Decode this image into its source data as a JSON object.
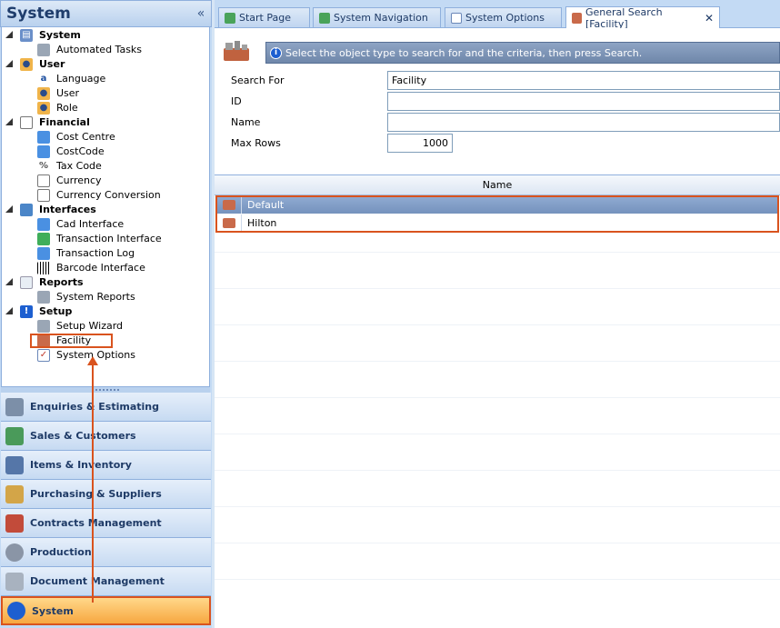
{
  "left": {
    "title": "System",
    "collapse": "«",
    "tree": [
      {
        "label": "System",
        "type": "group",
        "icon": "system-icon"
      },
      {
        "label": "Automated Tasks",
        "type": "child",
        "icon": "automated-tasks-icon"
      },
      {
        "label": "User",
        "type": "group",
        "icon": "user-icon"
      },
      {
        "label": "Language",
        "type": "child",
        "icon": "language-icon"
      },
      {
        "label": "User",
        "type": "child",
        "icon": "user-icon"
      },
      {
        "label": "Role",
        "type": "child",
        "icon": "role-icon"
      },
      {
        "label": "Financial",
        "type": "group",
        "icon": "financial-icon"
      },
      {
        "label": "Cost Centre",
        "type": "child",
        "icon": "cost-centre-icon"
      },
      {
        "label": "CostCode",
        "type": "child",
        "icon": "cost-code-icon"
      },
      {
        "label": "Tax Code",
        "type": "child",
        "icon": "tax-code-icon"
      },
      {
        "label": "Currency",
        "type": "child",
        "icon": "currency-icon"
      },
      {
        "label": "Currency Conversion",
        "type": "child",
        "icon": "currency-conversion-icon"
      },
      {
        "label": "Interfaces",
        "type": "group",
        "icon": "interfaces-icon"
      },
      {
        "label": "Cad Interface",
        "type": "child",
        "icon": "cad-interface-icon"
      },
      {
        "label": "Transaction Interface",
        "type": "child",
        "icon": "transaction-interface-icon"
      },
      {
        "label": "Transaction Log",
        "type": "child",
        "icon": "transaction-log-icon"
      },
      {
        "label": "Barcode Interface",
        "type": "child",
        "icon": "barcode-icon"
      },
      {
        "label": "Reports",
        "type": "group",
        "icon": "reports-icon"
      },
      {
        "label": "System Reports",
        "type": "child",
        "icon": "system-reports-icon"
      },
      {
        "label": "Setup",
        "type": "group",
        "icon": "setup-icon"
      },
      {
        "label": "Setup Wizard",
        "type": "child",
        "icon": "setup-wizard-icon"
      },
      {
        "label": "Facility",
        "type": "child",
        "icon": "facility-icon"
      },
      {
        "label": "System Options",
        "type": "child",
        "icon": "system-options-icon"
      }
    ],
    "nav": [
      "Enquiries & Estimating",
      "Sales & Customers",
      "Items & Inventory",
      "Purchasing & Suppliers",
      "Contracts Management",
      "Production",
      "Document Management",
      "System"
    ]
  },
  "tabs": [
    {
      "label": "Start Page"
    },
    {
      "label": "System Navigation"
    },
    {
      "label": "System Options"
    },
    {
      "label": "General Search [Facility]",
      "close": "✕"
    }
  ],
  "search": {
    "info": "Select the object type to search for and the criteria, then press Search.",
    "search_for_label": "Search For",
    "search_for_value": "Facility",
    "id_label": "ID",
    "id_value": "",
    "name_label": "Name",
    "name_value": "",
    "max_rows_label": "Max Rows",
    "max_rows_value": "1000"
  },
  "results": {
    "column": "Name",
    "rows": [
      "Default",
      "Hilton"
    ]
  },
  "colors": {
    "highlight": "#d9531e",
    "accent": "#f7a740"
  }
}
